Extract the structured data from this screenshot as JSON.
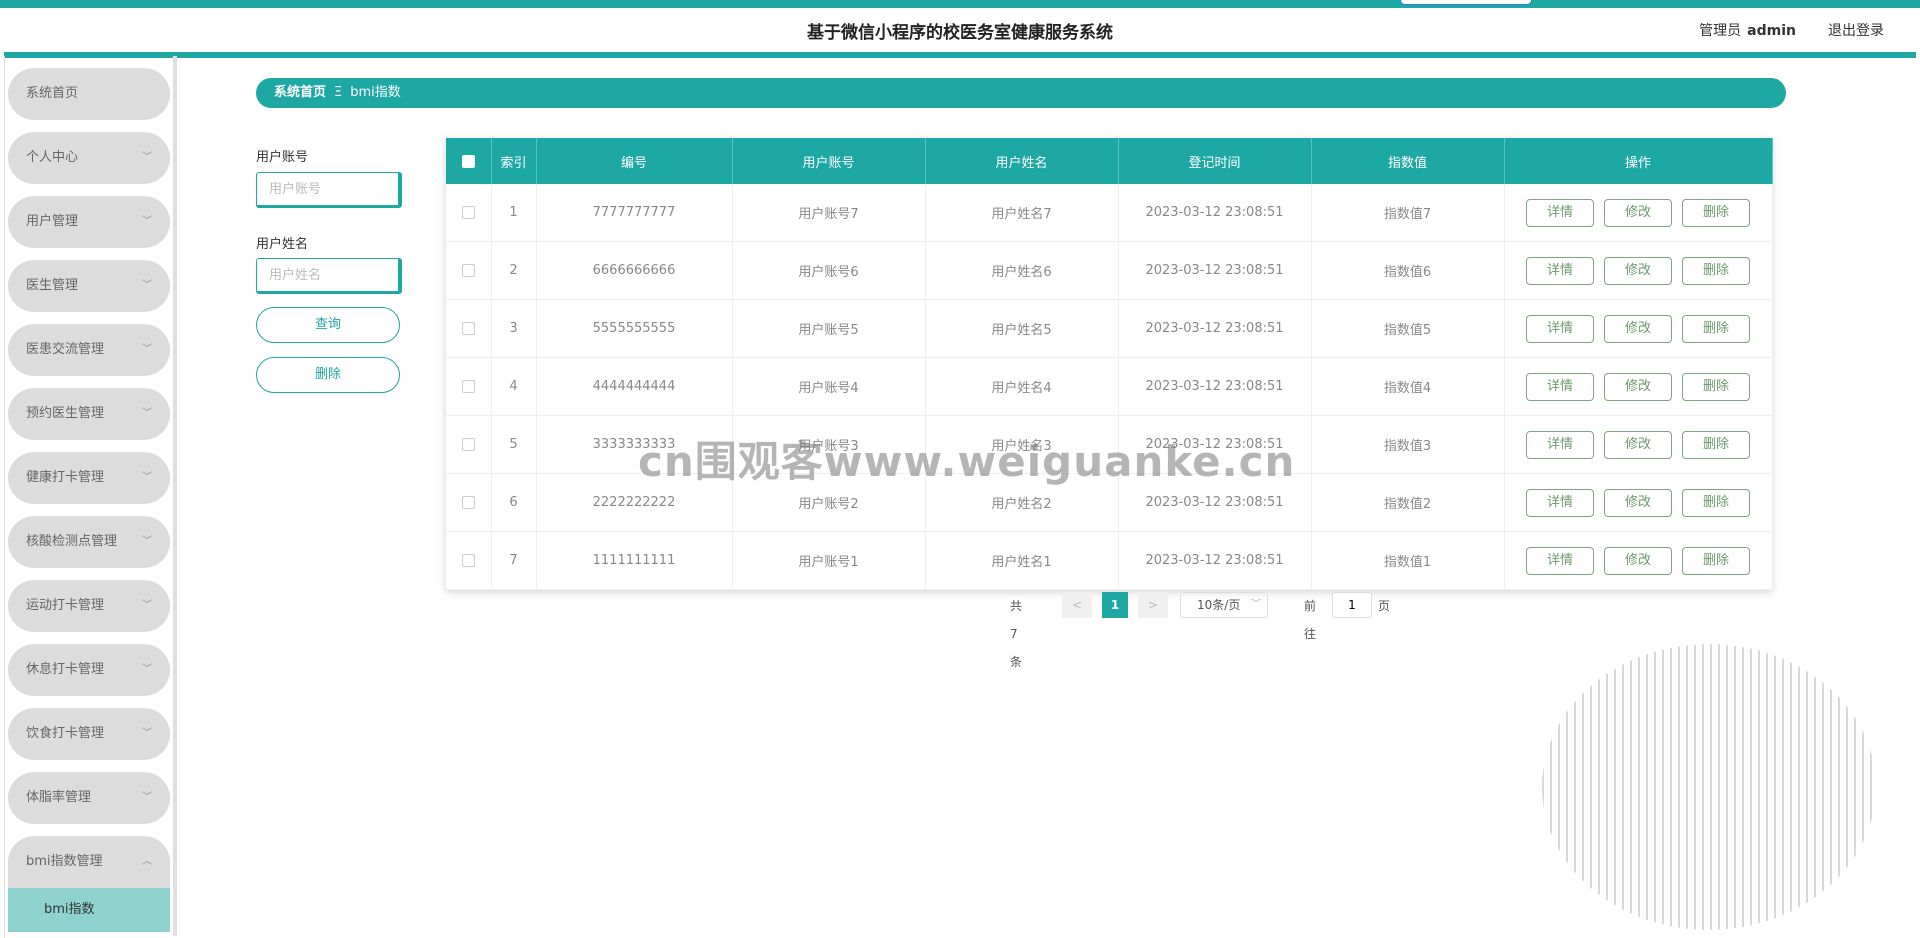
{
  "header": {
    "title": "基于微信小程序的校医务室健康服务系统",
    "user_role": "管理员",
    "username": "admin",
    "logout": "退出登录"
  },
  "sidebar": {
    "items": [
      {
        "label": "系统首页",
        "has_arrow": false
      },
      {
        "label": "个人中心",
        "has_arrow": true
      },
      {
        "label": "用户管理",
        "has_arrow": true
      },
      {
        "label": "医生管理",
        "has_arrow": true
      },
      {
        "label": "医患交流管理",
        "has_arrow": true
      },
      {
        "label": "预约医生管理",
        "has_arrow": true
      },
      {
        "label": "健康打卡管理",
        "has_arrow": true
      },
      {
        "label": "核酸检测点管理",
        "has_arrow": true
      },
      {
        "label": "运动打卡管理",
        "has_arrow": true
      },
      {
        "label": "休息打卡管理",
        "has_arrow": true
      },
      {
        "label": "饮食打卡管理",
        "has_arrow": true
      },
      {
        "label": "体脂率管理",
        "has_arrow": true
      },
      {
        "label": "bmi指数管理",
        "has_arrow": true,
        "open": true
      }
    ],
    "active_sub": "bmi指数"
  },
  "breadcrumb": {
    "home": "系统首页",
    "separator": "Ξ",
    "current": "bmi指数"
  },
  "search": {
    "account_label": "用户账号",
    "account_placeholder": "用户账号",
    "name_label": "用户姓名",
    "name_placeholder": "用户姓名",
    "query_button": "查询",
    "delete_button": "删除"
  },
  "table": {
    "columns": [
      "索引",
      "编号",
      "用户账号",
      "用户姓名",
      "登记时间",
      "指数值",
      "操作"
    ],
    "rows": [
      {
        "index": "1",
        "code": "7777777777",
        "account": "用户账号7",
        "name": "用户姓名7",
        "time": "2023-03-12 23:08:51",
        "value": "指数值7"
      },
      {
        "index": "2",
        "code": "6666666666",
        "account": "用户账号6",
        "name": "用户姓名6",
        "time": "2023-03-12 23:08:51",
        "value": "指数值6"
      },
      {
        "index": "3",
        "code": "5555555555",
        "account": "用户账号5",
        "name": "用户姓名5",
        "time": "2023-03-12 23:08:51",
        "value": "指数值5"
      },
      {
        "index": "4",
        "code": "4444444444",
        "account": "用户账号4",
        "name": "用户姓名4",
        "time": "2023-03-12 23:08:51",
        "value": "指数值4"
      },
      {
        "index": "5",
        "code": "3333333333",
        "account": "用户账号3",
        "name": "用户姓名3",
        "time": "2023-03-12 23:08:51",
        "value": "指数值3"
      },
      {
        "index": "6",
        "code": "2222222222",
        "account": "用户账号2",
        "name": "用户姓名2",
        "time": "2023-03-12 23:08:51",
        "value": "指数值2"
      },
      {
        "index": "7",
        "code": "1111111111",
        "account": "用户账号1",
        "name": "用户姓名1",
        "time": "2023-03-12 23:08:51",
        "value": "指数值1"
      }
    ],
    "actions": {
      "detail": "详情",
      "edit": "修改",
      "delete": "删除"
    }
  },
  "pagination": {
    "total": "共 7 条",
    "prev": "<",
    "current_page": "1",
    "next": ">",
    "page_size": "10条/页",
    "goto_label": "前往",
    "goto_value": "1",
    "goto_suffix": "页"
  },
  "watermark": "cn围观客www.weiguanke.cn",
  "colors": {
    "accent": "#1ea8a4",
    "sidebar_item": "#dcdcdc",
    "sidebar_active": "#8ed3cf",
    "action_border": "#7fa57f"
  }
}
